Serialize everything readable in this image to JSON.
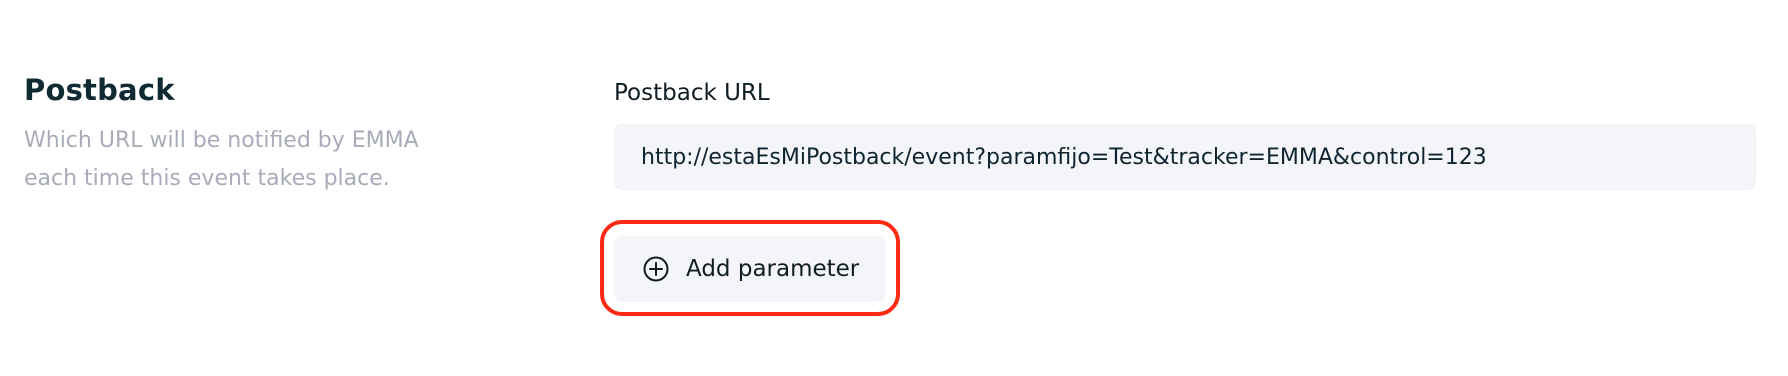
{
  "section": {
    "title": "Postback",
    "description": "Which URL will be notified by EMMA each time this event takes place."
  },
  "postback_url": {
    "label": "Postback URL",
    "value": "http://estaEsMiPostback/event?paramfijo=Test&tracker=EMMA&control=123"
  },
  "add_parameter": {
    "label": "Add parameter",
    "icon": "plus-circle-icon"
  },
  "colors": {
    "highlight": "#ff2a14",
    "field_bg": "#f4f5f8",
    "muted_text": "#a8acb8"
  }
}
